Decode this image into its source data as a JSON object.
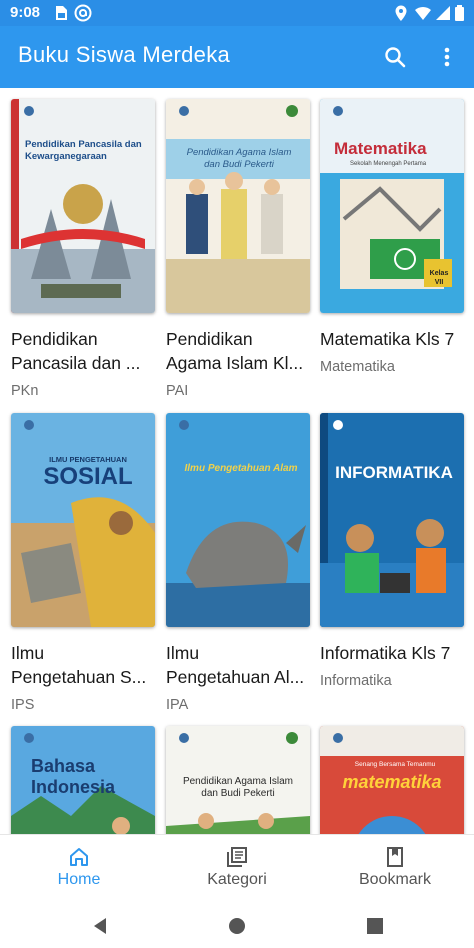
{
  "status_bar": {
    "time": "9:08",
    "left_icons": [
      "sim-card-icon",
      "circle-a-icon"
    ],
    "right_icons": [
      "location-icon",
      "wifi-icon",
      "signal-icon",
      "battery-icon"
    ]
  },
  "app_bar": {
    "title": "Buku Siswa Merdeka",
    "actions": [
      "search-icon",
      "more-vert-icon"
    ],
    "color": "#2e97ee"
  },
  "books": [
    {
      "title_lines": [
        "Pendidikan",
        "Pancasila dan ..."
      ],
      "subtitle": "PKn",
      "cover_text": "Pendidikan Pancasila dan Kewarganegaraan",
      "cover_color": "#e9eef0"
    },
    {
      "title_lines": [
        "Pendidikan",
        "Agama Islam Kl..."
      ],
      "subtitle": "PAI",
      "cover_text": "Pendidikan Agama Islam dan Budi Pekerti",
      "cover_color": "#f1ece2"
    },
    {
      "title_lines": [
        "Matematika Kls 7"
      ],
      "subtitle": "Matematika",
      "cover_text": "Matematika",
      "cover_sub": "Sekolah Menengah Pertama",
      "cover_badge": "Kelas VII",
      "cover_color": "#3aa9e0"
    },
    {
      "title_lines": [
        "Ilmu",
        "Pengetahuan S..."
      ],
      "subtitle": "IPS",
      "cover_text": "SOSIAL",
      "cover_sub": "ILMU PENGETAHUAN",
      "cover_color": "#5aa8dc"
    },
    {
      "title_lines": [
        "Ilmu",
        "Pengetahuan Al..."
      ],
      "subtitle": "IPA",
      "cover_text": "Ilmu Pengetahuan Alam",
      "cover_color": "#3f9ed9"
    },
    {
      "title_lines": [
        "Informatika Kls 7"
      ],
      "subtitle": "Informatika",
      "cover_text": "INFORMATIKA",
      "cover_color": "#1c6fb0"
    },
    {
      "title_lines": [
        ""
      ],
      "subtitle": "",
      "cover_text": "Bahasa Indonesia",
      "cover_color": "#59a8e0"
    },
    {
      "title_lines": [
        ""
      ],
      "subtitle": "",
      "cover_text": "Pendidikan Agama Islam dan Budi Pekerti",
      "cover_color": "#f3f3ee"
    },
    {
      "title_lines": [
        ""
      ],
      "subtitle": "",
      "cover_text": "matematika",
      "cover_sub": "Senang Bersama Temanmu",
      "cover_color": "#d84a3a"
    }
  ],
  "bottom_nav": {
    "items": [
      {
        "label": "Home",
        "icon": "home-icon",
        "active": true
      },
      {
        "label": "Kategori",
        "icon": "library-books-icon",
        "active": false
      },
      {
        "label": "Bookmark",
        "icon": "bookmark-icon",
        "active": false
      }
    ]
  },
  "system_nav": [
    "back-triangle-icon",
    "home-circle-icon",
    "recents-square-icon"
  ]
}
